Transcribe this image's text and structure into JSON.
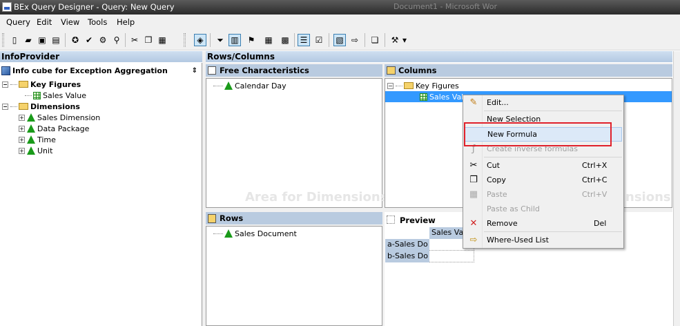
{
  "window": {
    "title": "BEx Query Designer - Query: New Query",
    "bg_window_text": "Document1 - Microsoft Wor"
  },
  "menu": [
    "Query",
    "Edit",
    "View",
    "Tools",
    "Help"
  ],
  "infoprovider": {
    "header": "InfoProvider",
    "cube": "Info cube for Exception Aggregation",
    "tree": [
      {
        "label": "Key Figures",
        "icon": "folder-icon",
        "bold": true
      },
      {
        "label": "Sales Value",
        "icon": "key-figure-icon",
        "bold": false
      },
      {
        "label": "Dimensions",
        "icon": "folder-icon",
        "bold": true
      },
      {
        "label": "Sales Dimension",
        "icon": "characteristic-icon",
        "bold": false
      },
      {
        "label": "Data Package",
        "icon": "characteristic-icon",
        "bold": false
      },
      {
        "label": "Time",
        "icon": "characteristic-icon",
        "bold": false
      },
      {
        "label": "Unit",
        "icon": "characteristic-icon",
        "bold": false
      }
    ]
  },
  "rows_columns": {
    "header": "Rows/Columns",
    "free_characteristics": {
      "title": "Free Characteristics",
      "items": [
        "Calendar Day"
      ]
    },
    "columns": {
      "title": "Columns",
      "items": [
        "Key Figures",
        "Sales Val"
      ]
    },
    "rows": {
      "title": "Rows",
      "items": [
        "Sales Document"
      ]
    },
    "watermark_left": "Area for Dimensions",
    "watermark_right": "nsions",
    "preview": {
      "title": "Preview",
      "col_header": "Sales Val",
      "rows": [
        "a-Sales Do",
        "b-Sales Do"
      ]
    }
  },
  "context_menu": [
    {
      "label": "Edit...",
      "shortcut": "",
      "icon": "edit-icon",
      "disabled": false
    },
    {
      "label": "New Selection",
      "shortcut": "",
      "icon": "",
      "disabled": false
    },
    {
      "label": "New Formula",
      "shortcut": "",
      "icon": "",
      "disabled": false,
      "highlighted": true
    },
    {
      "label": "Create inverse formulas",
      "shortcut": "",
      "icon": "formula-icon",
      "disabled": true
    },
    {
      "label": "Cut",
      "shortcut": "Ctrl+X",
      "icon": "scissors-icon",
      "disabled": false
    },
    {
      "label": "Copy",
      "shortcut": "Ctrl+C",
      "icon": "copy-icon",
      "disabled": false
    },
    {
      "label": "Paste",
      "shortcut": "Ctrl+V",
      "icon": "paste-icon",
      "disabled": true
    },
    {
      "label": "Paste as Child",
      "shortcut": "",
      "icon": "",
      "disabled": true
    },
    {
      "label": "Remove",
      "shortcut": "Del",
      "icon": "remove-icon",
      "disabled": false
    },
    {
      "label": "Where-Used List",
      "shortcut": "",
      "icon": "where-used-icon",
      "disabled": false
    }
  ],
  "colors": {
    "header_blue": "#b9cbe0",
    "highlight_red": "#e0202a",
    "selection": "#3399ff"
  }
}
